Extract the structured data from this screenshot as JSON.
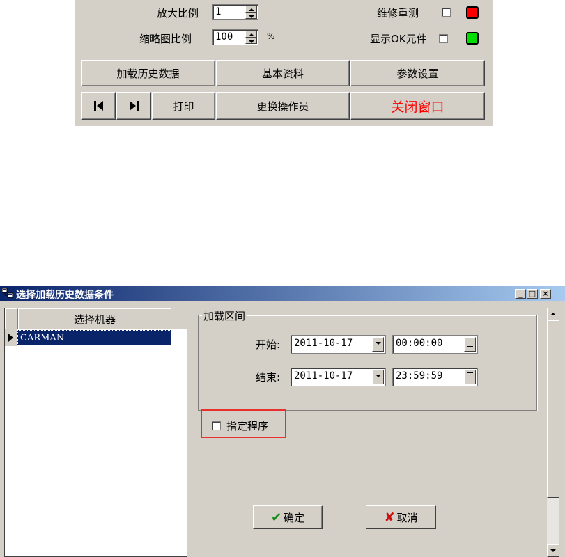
{
  "top_panel": {
    "zoom_label": "放大比例",
    "zoom_value": "1",
    "thumb_label": "缩略图比例",
    "thumb_value": "100",
    "thumb_unit": "%",
    "retest_label": "维修重测",
    "show_ok_label": "显示OK元件",
    "buttons": {
      "load_history": "加载历史数据",
      "basic_info": "基本资料",
      "param_settings": "参数设置",
      "print": "打印",
      "change_operator": "更换操作员",
      "close_window": "关闭窗口"
    },
    "colors": {
      "red_indicator": "#ff0000",
      "green_indicator": "#00dd00",
      "close_text": "#ff0000"
    }
  },
  "dialog": {
    "title": "选择加载历史数据条件",
    "grid": {
      "column_header": "选择机器",
      "rows": [
        "CARMAN"
      ]
    },
    "group_title": "加载区间",
    "start_label": "开始:",
    "start_date": "2011-10-17",
    "start_time": "00:00:00",
    "end_label": "结束:",
    "end_date": "2011-10-17",
    "end_time": "23:59:59",
    "specify_program_label": "指定程序",
    "ok_label": "确定",
    "cancel_label": "取消",
    "colors": {
      "title_bar": "#0a246a",
      "selection": "#0a246a",
      "highlight_box": "#e8312f"
    }
  }
}
